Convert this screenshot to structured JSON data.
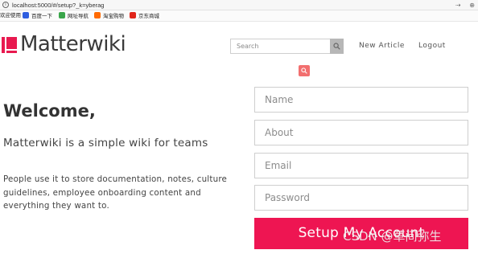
{
  "browser": {
    "url": "localhost:5000/#/setup?_k=yberag",
    "bookmarks": [
      {
        "label": "欢迎使用",
        "color": "#ffffff"
      },
      {
        "label": "百度一下",
        "color": "#2f5ee0"
      },
      {
        "label": "网址导航",
        "color": "#3aa64b"
      },
      {
        "label": "淘宝购物",
        "color": "#ff6a00"
      },
      {
        "label": "京东商城",
        "color": "#e1251b"
      }
    ]
  },
  "header": {
    "logo_text": "Matterwiki",
    "search_placeholder": "Search",
    "nav_new_article": "New Article",
    "nav_logout": "Logout"
  },
  "welcome": {
    "title": "Welcome,",
    "tagline": "Matterwiki is a simple wiki for teams",
    "description": "People use it to store documentation, notes, culture guidelines, employee onboarding content and everything they want to."
  },
  "form": {
    "name_placeholder": "Name",
    "about_placeholder": "About",
    "email_placeholder": "Email",
    "password_placeholder": "Password",
    "submit_label": "Setup My Account"
  },
  "watermark": "CSDN @草间弥生",
  "colors": {
    "brand": "#e8194f",
    "button": "#ee1552",
    "floating_search": "#f26f6f"
  }
}
